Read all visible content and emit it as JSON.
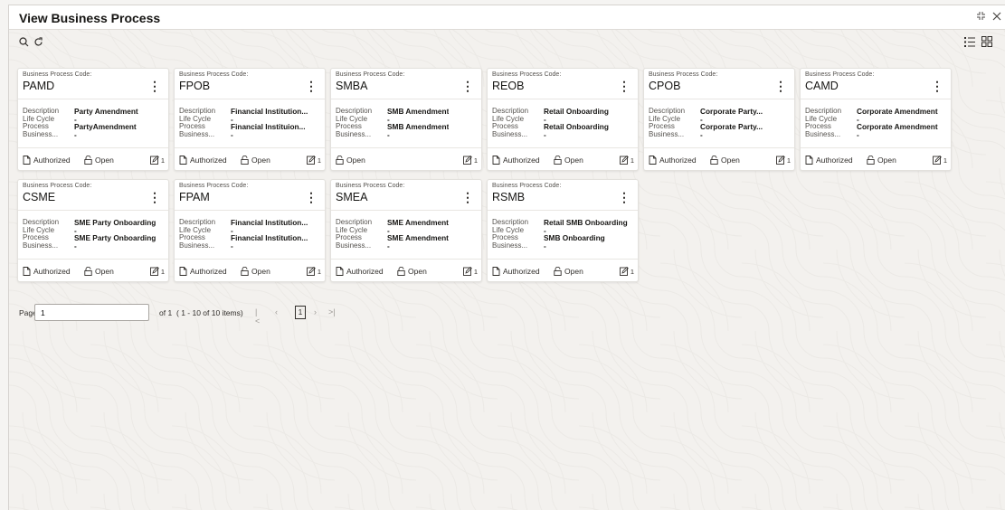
{
  "window": {
    "title": "View Business Process"
  },
  "toolbar": {
    "search_icon": "search-icon",
    "refresh_icon": "refresh-icon"
  },
  "card_labels": {
    "header": "Business Process Code:",
    "description": "Description",
    "life_cycle": "Life Cycle",
    "process": "Process",
    "business": "Business..."
  },
  "cards": [
    {
      "code": "PAMD",
      "description": "Party Amendment",
      "life_cycle": "-",
      "process": "PartyAmendment",
      "business": "-",
      "status": "Authorized",
      "lock": "Open",
      "edit_count": "1"
    },
    {
      "code": "FPOB",
      "description": "Financial Institution...",
      "life_cycle": "-",
      "process": "Financial Instituion...",
      "business": "-",
      "status": "Authorized",
      "lock": "Open",
      "edit_count": "1"
    },
    {
      "code": "SMBA",
      "description": "SMB Amendment",
      "life_cycle": "-",
      "process": "SMB Amendment",
      "business": "-",
      "status": "",
      "lock": "Open",
      "edit_count": "1"
    },
    {
      "code": "REOB",
      "description": "Retail Onboarding",
      "life_cycle": "-",
      "process": "Retail Onboarding",
      "business": "-",
      "status": "Authorized",
      "lock": "Open",
      "edit_count": "1"
    },
    {
      "code": "CPOB",
      "description": "Corporate Party...",
      "life_cycle": "-",
      "process": "Corporate Party...",
      "business": "-",
      "status": "Authorized",
      "lock": "Open",
      "edit_count": "1"
    },
    {
      "code": "CAMD",
      "description": "Corporate Amendment",
      "life_cycle": "-",
      "process": "Corporate Amendment",
      "business": "-",
      "status": "Authorized",
      "lock": "Open",
      "edit_count": "1"
    },
    {
      "code": "CSME",
      "description": "SME Party Onboarding",
      "life_cycle": "-",
      "process": "SME Party Onboarding",
      "business": "-",
      "status": "Authorized",
      "lock": "Open",
      "edit_count": "1"
    },
    {
      "code": "FPAM",
      "description": "Financial Institution...",
      "life_cycle": "-",
      "process": "Financial Institution...",
      "business": "-",
      "status": "Authorized",
      "lock": "Open",
      "edit_count": "1"
    },
    {
      "code": "SMEA",
      "description": "SME Amendment",
      "life_cycle": "-",
      "process": "SME Amendment",
      "business": "-",
      "status": "Authorized",
      "lock": "Open",
      "edit_count": "1"
    },
    {
      "code": "RSMB",
      "description": "Retail SMB Onboarding",
      "life_cycle": "-",
      "process": "SMB Onboarding",
      "business": "-",
      "status": "Authorized",
      "lock": "Open",
      "edit_count": "1"
    }
  ],
  "pagination": {
    "page_label": "Page",
    "page_value": "1",
    "of_label": "of 1",
    "items_label": "( 1 - 10 of 10 items)",
    "current_page": "1"
  },
  "colors": {
    "card_bg": "#ffffff",
    "page_bg": "#f3f1ee",
    "text": "#161513"
  }
}
